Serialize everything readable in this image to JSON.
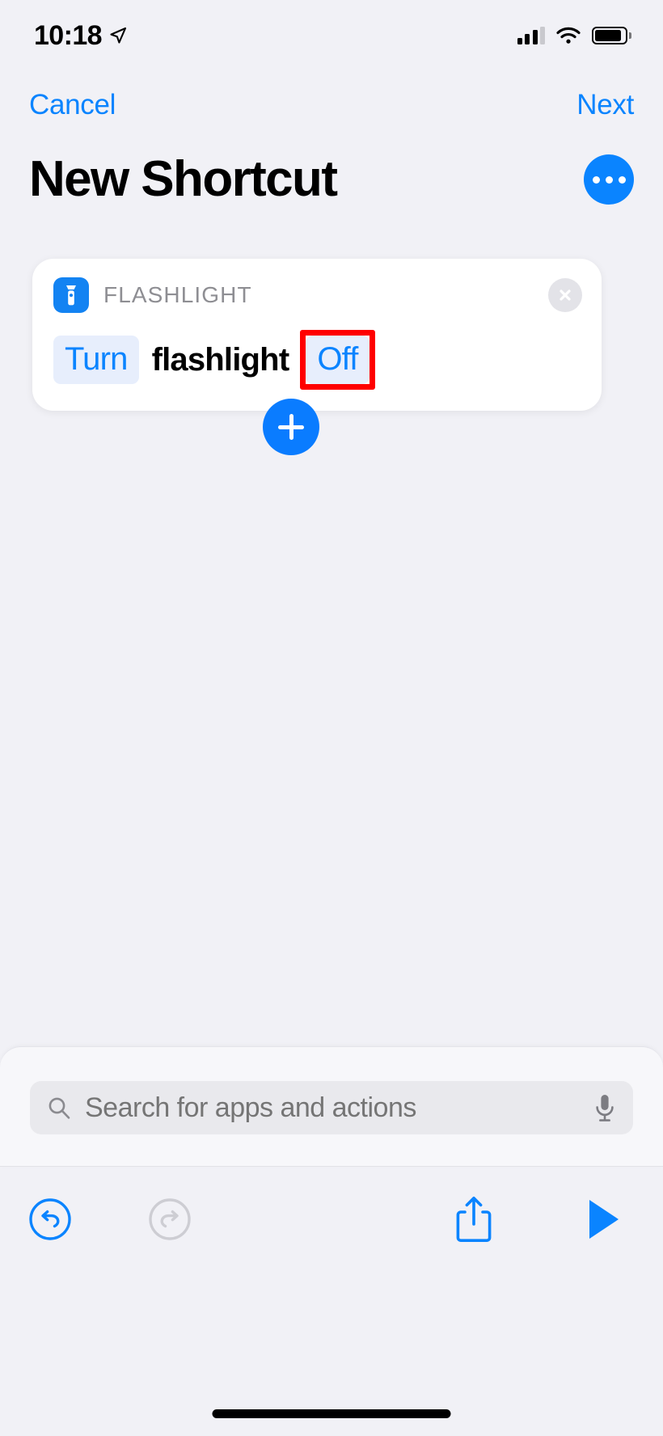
{
  "status_bar": {
    "time": "10:18",
    "location_icon": "location-arrow-icon",
    "cellular_icon": "cellular-signal-icon",
    "cellular_bars_filled": 3,
    "cellular_bars_total": 4,
    "wifi_icon": "wifi-icon",
    "battery_icon": "battery-icon",
    "battery_level_percent": 90
  },
  "nav_bar": {
    "cancel_label": "Cancel",
    "next_label": "Next"
  },
  "header": {
    "title": "New Shortcut",
    "more_icon": "more-ellipsis-icon",
    "accent_color": "#0a84ff"
  },
  "action_card": {
    "app_icon": "flashlight-icon",
    "app_icon_color": "#1383f2",
    "app_name": "FLASHLIGHT",
    "close_icon": "close-circle-icon",
    "parts": {
      "verb_token": "Turn",
      "object_text": "flashlight",
      "state_token": "Off"
    },
    "highlight": {
      "target": "Off",
      "color": "#ff0000"
    }
  },
  "add_action": {
    "add_icon": "plus-icon",
    "color": "#0a7cff"
  },
  "search": {
    "search_icon": "search-icon",
    "placeholder": "Search for apps and actions",
    "value": "",
    "mic_icon": "microphone-icon"
  },
  "toolbar": {
    "undo_icon": "undo-icon",
    "undo_enabled": true,
    "redo_icon": "redo-icon",
    "redo_enabled": false,
    "share_icon": "share-icon",
    "play_icon": "play-icon",
    "enabled_color": "#0a84ff",
    "disabled_color": "#cdcdd3"
  },
  "home_indicator": "home-indicator"
}
